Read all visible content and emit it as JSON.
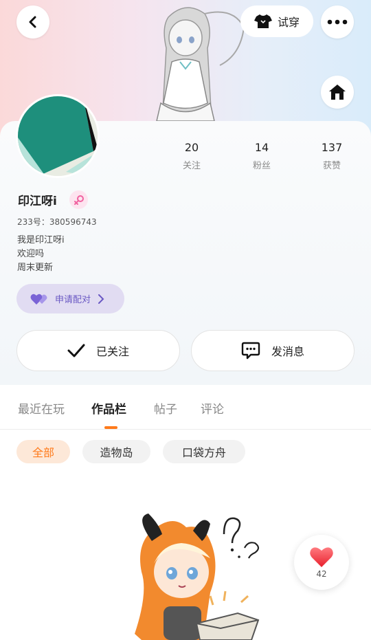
{
  "header": {
    "tryon_label": "试穿",
    "icons": {
      "back": "back-arrow-icon",
      "more": "more-dots-icon",
      "home": "home-icon",
      "tryon": "tshirt-icon"
    }
  },
  "profile": {
    "stats": [
      {
        "value": "20",
        "label": "关注"
      },
      {
        "value": "14",
        "label": "粉丝"
      },
      {
        "value": "137",
        "label": "获赞"
      }
    ],
    "username": "印江呀i",
    "id_text": "233号：380596743",
    "bio": [
      "我是印江呀i",
      "欢迎吗",
      "周末更新"
    ],
    "match_label": "申请配对",
    "gender_color": "#f062a0"
  },
  "actions": {
    "followed_label": "已关注",
    "message_label": "发消息"
  },
  "tabs": [
    {
      "label": "最近在玩",
      "active": false
    },
    {
      "label": "作品栏",
      "active": true
    },
    {
      "label": "帖子",
      "active": false
    },
    {
      "label": "评论",
      "active": false
    }
  ],
  "filters": [
    {
      "label": "全部",
      "active": true
    },
    {
      "label": "造物岛",
      "active": false
    },
    {
      "label": "口袋方舟",
      "active": false
    }
  ],
  "like": {
    "count": "42"
  },
  "colors": {
    "accent": "#ff7a1a",
    "match": "#6a59c4",
    "like": "#f23b4a"
  }
}
